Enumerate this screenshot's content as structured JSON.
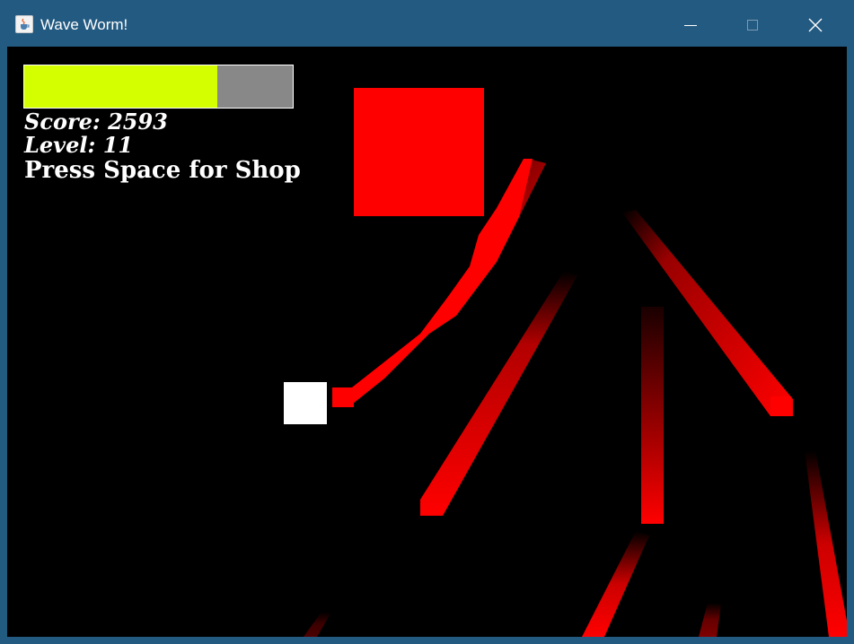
{
  "window": {
    "title": "Wave Worm!",
    "icons": {
      "app": "java-cup-icon",
      "minimize": "minimize-icon",
      "maximize": "maximize-icon",
      "close": "close-icon"
    }
  },
  "hud": {
    "health_fraction": 0.72,
    "health_color": "#d4ff00",
    "health_empty_color": "#888888",
    "score_text": "Score: 2593",
    "level_text": "Level: 11",
    "shop_hint": "Press Space for Shop"
  },
  "colors": {
    "background": "#000000",
    "enemy": "#ff0000",
    "player": "#ffffff",
    "titlebar": "#235a81"
  }
}
